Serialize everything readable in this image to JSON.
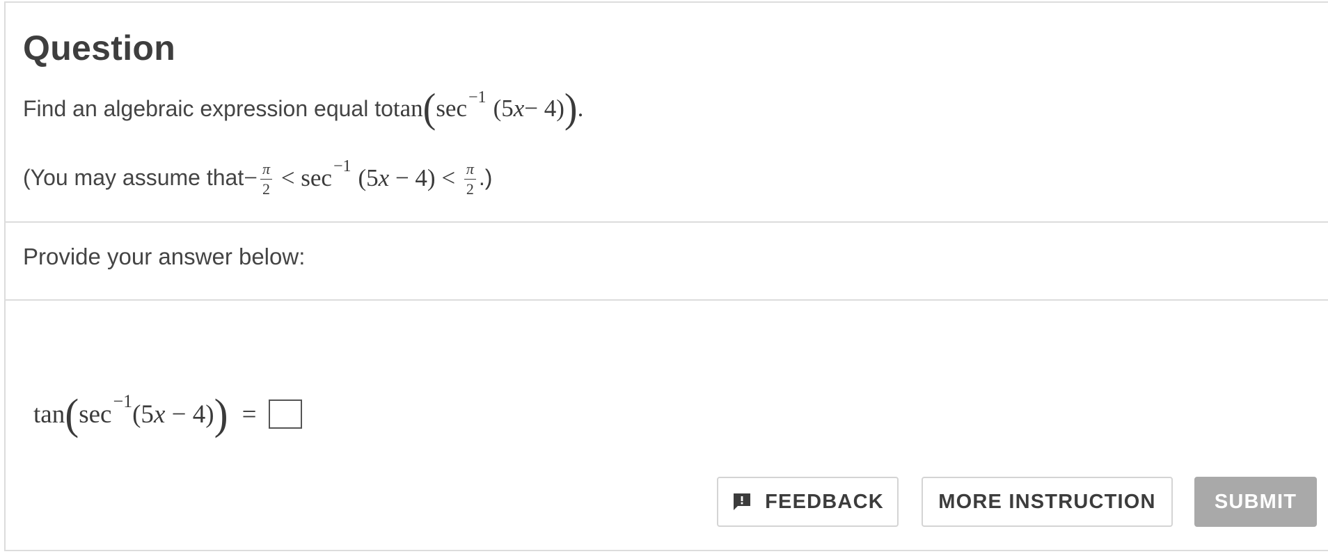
{
  "question": {
    "title": "Question",
    "line1_text": "Find an algebraic expression equal to ",
    "line1_math": {
      "fn_outer": "tan",
      "fn_inner": "sec",
      "exponent": "−1",
      "arg_open": "(5",
      "arg_var": "x",
      "arg_rest": " − 4)",
      "end": "."
    },
    "line2_text": "(You may assume that ",
    "line2_math": {
      "neg": "−",
      "frac_num": "π",
      "frac_den": "2",
      "lt1": " < ",
      "fn": "sec",
      "exponent": "−1",
      "arg_open": "(5",
      "arg_var": "x",
      "arg_rest": " − 4)",
      "lt2": " < ",
      "end": ".)"
    }
  },
  "prompt": {
    "text": "Provide your answer below:"
  },
  "answer": {
    "fn_outer": "tan",
    "fn_inner": "sec",
    "exponent": "−1",
    "arg_open": "(5",
    "arg_var": "x",
    "arg_rest": " − 4)",
    "equals": "="
  },
  "buttons": {
    "feedback": "FEEDBACK",
    "more_instruction": "MORE INSTRUCTION",
    "submit": "SUBMIT"
  },
  "icons": {
    "feedback": "feedback-icon"
  },
  "colors": {
    "submit_disabled": "#a9a9a9",
    "border": "#dcdcdc"
  }
}
